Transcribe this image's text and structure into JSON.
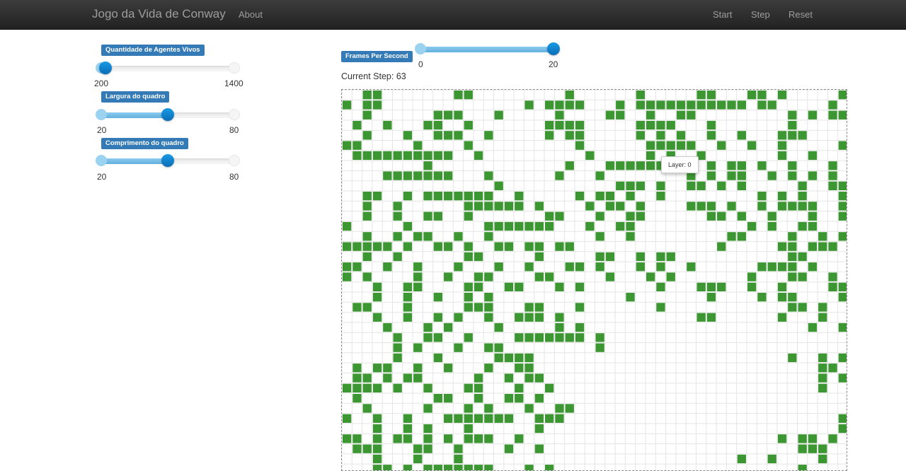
{
  "navbar": {
    "brand": "Jogo da Vida de Conway",
    "about": "About",
    "start": "Start",
    "step": "Step",
    "reset": "Reset"
  },
  "sliders": {
    "agents": {
      "label": "Quantidade de Agentes Vivos",
      "min_label": "200",
      "max_label": "1400",
      "min": 200,
      "max": 1400,
      "value": 240
    },
    "width": {
      "label": "Largura do quadro",
      "min_label": "20",
      "max_label": "80",
      "min": 20,
      "max": 80,
      "value": 50
    },
    "length": {
      "label": "Comprimento do quadro",
      "min_label": "20",
      "max_label": "80",
      "min": 20,
      "max": 80,
      "value": 50
    },
    "fps": {
      "label": "Frames Per Second",
      "min_label": "0",
      "max_label": "20",
      "min": 0,
      "max": 20,
      "value": 20
    }
  },
  "status": {
    "current_step": "Current Step: 63"
  },
  "tooltip": {
    "text": "Layer: 0"
  },
  "board": {
    "cols": 50,
    "rows": 38,
    "alive_color": "#3c9632",
    "grid_color": "#e5e5e5",
    "grid": [
      "..##.......##.........#......#.....##...##.#.....#.....#...#..",
      "#.##..............#.####...#.###########.##.....#...#...#.##",
      "..#......###...#.....#....##..#..##.........#.#.######.....#.",
      ".#..#...##..#.......####.....####...#.......#......#....#.#.",
      "..#...#..###..#.....#.##.....#.#.#..#..#...###.....#.#.#####.#",
      "##.....#....#..........#......#####..#..#..#.....#...##.##....#",
      ".##########..#..........#.....#.#..#.......#..#....#..#.#...##.#",
      "........#.............#...#########.#.##.#..#...#.....#.##.##",
      "....#######...#......#...#........#.#.##..#.#.#.#.##..#..#..##",
      "...............#...........###.#..##.#.#.....#..###.###.#.#",
      "..##..#.#######..#.....#.##.#..#.........#.#.#...#.##..#.#.",
      "..#..#......######.#....#.##.#....###.#..#.####..#.####",
      "..#..#..##..#.......##...#..##......##.#..#...#..#.##.#..##",
      "#.....#.......#######...#..##...........#.#..##.....######",
      "..#..#.##..#..#..........#..#.........##....#..#.##.#......##",
      "#####.#..##.#..##.##.##..............#.....##.###..#.#######",
      "..#..#......##.....#.....##..#.##...........##......###..####",
      "##..#..#...#...#..#...##.#...#.#..#......####.#....#..###..#",
      "#.#....#..#..##....##.....#...#.#.......#...##..#.#......#",
      "...#..##....##..##...#.#.......#...###..#..#....##...#..#",
      "...#..#..#..#.#.............#.......#....#.##....#.###..##",
      ".##...#.....###...##...#.......#............##.#....#.#",
      "...#..#..#.#..#..###.#.............##......#...#...###.#",
      "....#...#.#....#.....#.#......................#..##...#..#",
      ".....#..##..#....#######.#.........................##..#.#",
      ".....#.#...#..##.........#..........................##...#",
      ".....#...#.....####.........................#..#.##..#.#..##",
      ".#.##..#..#...#..##............................##.#.#.###.#",
      ".##.#.##.....#..#.##...........................#.#...#.#.#.#",
      "####.#..#...##...#..#..........................#....##..##.#",
      ".#.......##..#..##.#...................................#.#..#",
      "..#.....#...#.#...#..##..............................##...#..#",
      "#..#..#...#######..###...........................#...#.#..#.",
      "...#..#.#...#......#.............................##..###..#.",
      "##.#.##.#.#.###..#.........................#.##.#.#.###.##",
      ".###...##..#....#..#.........................###..#..#..#.",
      "...#...#...#...........................#..#....#...#..#..#",
      "...##.#.#######...#.#........................#......#....#"
    ]
  }
}
